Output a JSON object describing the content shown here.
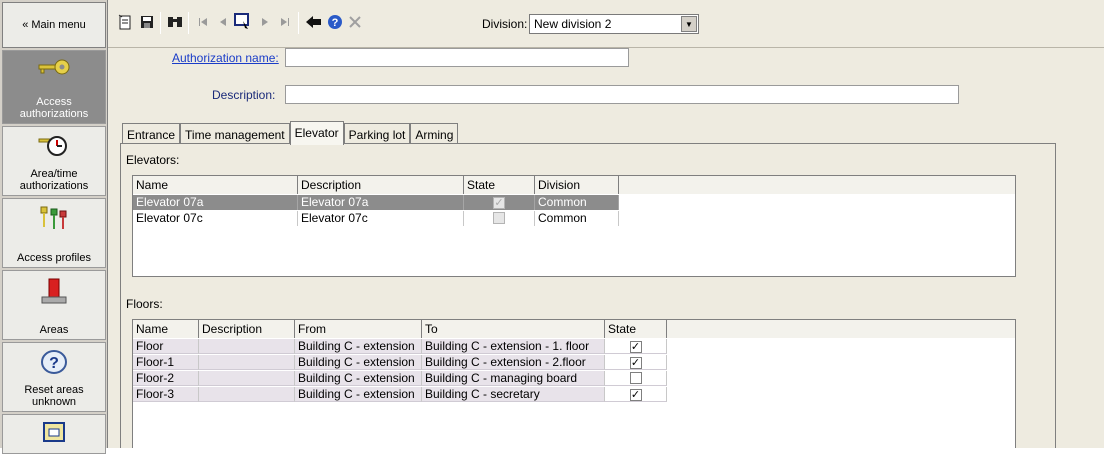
{
  "sidebar": {
    "main_menu": "« Main menu",
    "items": [
      {
        "label": "Access\nauthorizations",
        "icon": "key-icon"
      },
      {
        "label": "Area/time\nauthorizations",
        "icon": "key-clock-icon"
      },
      {
        "label": "Access profiles",
        "icon": "keys-icon"
      },
      {
        "label": "Areas",
        "icon": "area-marker-icon"
      },
      {
        "label": "Reset areas\nunknown",
        "icon": "question-bubble-icon"
      }
    ]
  },
  "toolbar": {
    "division_label": "Division:",
    "division_value": "New division 2"
  },
  "form": {
    "auth_name_label": "Authorization name:",
    "auth_name_value": "",
    "description_label": "Description:",
    "description_value": ""
  },
  "tabs": [
    "Entrance",
    "Time management",
    "Elevator",
    "Parking lot",
    "Arming"
  ],
  "elevators": {
    "label": "Elevators:",
    "columns": [
      "Name",
      "Description",
      "State",
      "Division"
    ],
    "rows": [
      {
        "name": "Elevator 07a",
        "description": "Elevator 07a",
        "state": true,
        "division": "Common",
        "selected": true
      },
      {
        "name": "Elevator 07c",
        "description": "Elevator 07c",
        "state": false,
        "division": "Common",
        "selected": false
      }
    ]
  },
  "floors": {
    "label": "Floors:",
    "columns": [
      "Name",
      "Description",
      "From",
      "To",
      "State"
    ],
    "rows": [
      {
        "name": "Floor",
        "description": "",
        "from": "Building C - extension",
        "to": "Building C - extension - 1. floor",
        "state": true
      },
      {
        "name": "Floor-1",
        "description": "",
        "from": "Building C - extension",
        "to": "Building C - extension - 2.floor",
        "state": true
      },
      {
        "name": "Floor-2",
        "description": "",
        "from": "Building C - extension",
        "to": "Building C - managing board",
        "state": false
      },
      {
        "name": "Floor-3",
        "description": "",
        "from": "Building C - extension",
        "to": "Building C - secretary",
        "state": true
      }
    ]
  },
  "colors": {
    "background": "#eeebe0",
    "selection": "#8c8c8c",
    "link": "#1a3cc8"
  }
}
